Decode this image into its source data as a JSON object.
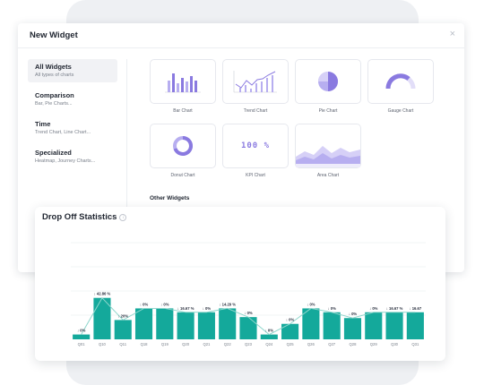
{
  "modal": {
    "title": "New Widget",
    "close_glyph": "×",
    "sidebar": [
      {
        "title": "All Widgets",
        "subtitle": "All types of charts",
        "active": true
      },
      {
        "title": "Comparison",
        "subtitle": "Bar, Pie Charts..."
      },
      {
        "title": "Time",
        "subtitle": "Trend Chart, Line Chart..."
      },
      {
        "title": "Specialized",
        "subtitle": "Heatmap, Journey Charts..."
      }
    ],
    "widgets": [
      {
        "label": "Bar Chart",
        "icon": "bar-chart-icon"
      },
      {
        "label": "Trend Chart",
        "icon": "trend-chart-icon"
      },
      {
        "label": "Pie Chart",
        "icon": "pie-chart-icon"
      },
      {
        "label": "Gauge Chart",
        "icon": "gauge-chart-icon"
      },
      {
        "label": "Donut Chart",
        "icon": "donut-chart-icon"
      },
      {
        "label": "KPI Chart",
        "icon": "kpi-chart-icon",
        "icon_text": "100 %"
      },
      {
        "label": "Area Chart",
        "icon": "area-chart-icon"
      }
    ],
    "other_widgets_label": "Other Widgets"
  },
  "stats": {
    "title": "Drop Off Statistics",
    "info_glyph": "i"
  },
  "colors": {
    "accent_purple": "#8a7ae0",
    "bar_teal": "#14a99b",
    "line_teal": "#8fd6cc"
  },
  "chart_data": {
    "type": "bar",
    "title": "Drop Off Statistics",
    "categories": [
      "Q01",
      "Q10",
      "Q11",
      "Q18",
      "Q19",
      "Q20",
      "Q21",
      "Q22",
      "Q23",
      "Q24",
      "Q25",
      "Q26",
      "Q27",
      "Q28",
      "Q29",
      "Q30",
      "Q31"
    ],
    "values": [
      5,
      42.86,
      20,
      32,
      32,
      28,
      28,
      32,
      23,
      5,
      16,
      32,
      28,
      22,
      28,
      28,
      28
    ],
    "data_labels": [
      "↓ 0%",
      "↓ 42.86 %",
      "↓ 20%",
      "↓ 0%",
      "↓ 0%",
      "↓ 16.67 %",
      "↓ 0%",
      "↓ 14.29 %",
      "↓ 0%",
      "↓ 0%",
      "↓ 0%",
      "↓ 0%",
      "↓ 0%",
      "↓ 0%",
      "↓ 0%",
      "↓ 16.67 %",
      "↓ 16.67"
    ],
    "ylim": [
      0,
      100
    ],
    "grid": true,
    "legend": "none"
  }
}
